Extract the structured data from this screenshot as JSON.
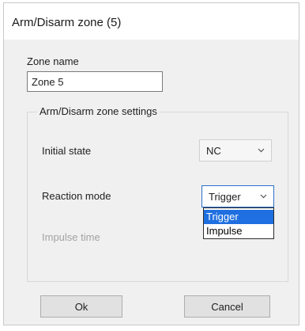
{
  "window": {
    "title": "Arm/Disarm zone (5)"
  },
  "zone_name": {
    "label": "Zone name",
    "value": "Zone 5"
  },
  "settings_group": {
    "title": "Arm/Disarm zone settings",
    "initial_state": {
      "label": "Initial state",
      "value": "NC"
    },
    "reaction_mode": {
      "label": "Reaction mode",
      "value": "Trigger",
      "options": [
        "Trigger",
        "Impulse"
      ],
      "highlighted": "Trigger"
    },
    "impulse_time": {
      "label": "Impulse time"
    }
  },
  "buttons": {
    "ok": "Ok",
    "cancel": "Cancel"
  },
  "colors": {
    "selection": "#1f6fe0",
    "focus_border": "#2c6fcf",
    "disabled_text": "#a3a3a3"
  },
  "icons": {
    "combo_arrow": "chevron-down-icon"
  }
}
